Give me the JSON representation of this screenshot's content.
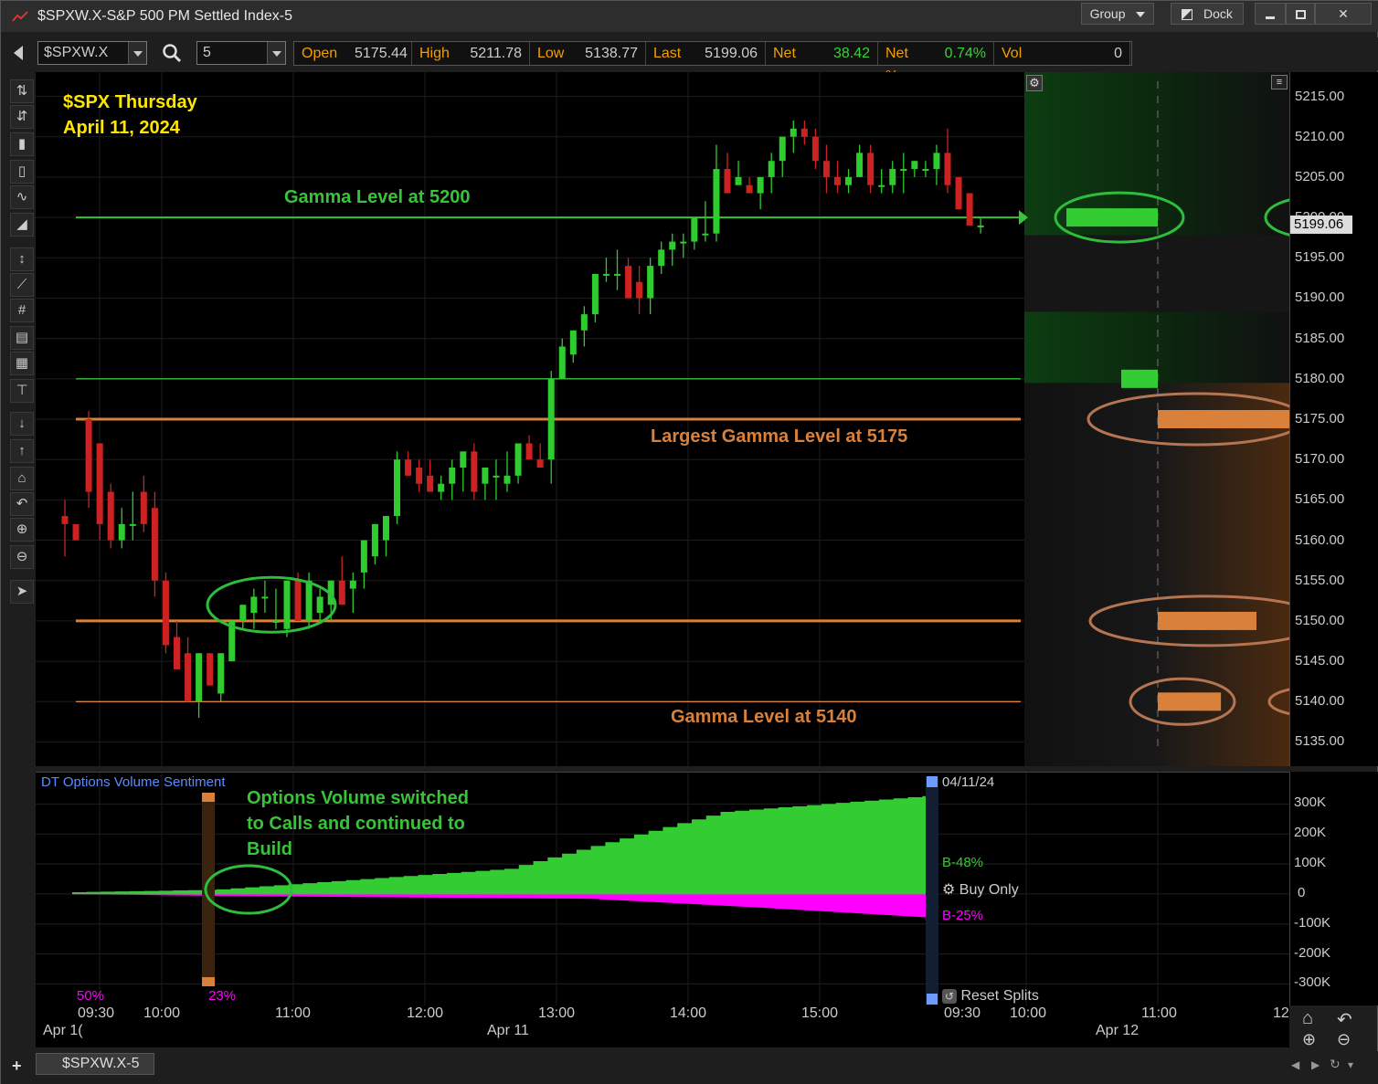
{
  "window": {
    "title": "$SPXW.X-S&P 500 PM Settled Index-5",
    "group_label": "Group",
    "dock_label": "Dock"
  },
  "toolbar": {
    "symbol": "$SPXW.X",
    "interval": "5",
    "quote": [
      {
        "label": "Open",
        "value": "5175.44",
        "color": "#cccccc"
      },
      {
        "label": "High",
        "value": "5211.78",
        "color": "#cccccc"
      },
      {
        "label": "Low",
        "value": "5138.77",
        "color": "#cccccc"
      },
      {
        "label": "Last",
        "value": "5199.06",
        "color": "#cccccc"
      },
      {
        "label": "Net",
        "value": "38.42",
        "color": "#3ccf3c"
      },
      {
        "label": "Net %",
        "value": "0.74%",
        "color": "#3ccf3c"
      },
      {
        "label": "Vol",
        "value": "0",
        "color": "#cccccc"
      }
    ]
  },
  "annotations": {
    "title_line1": "$SPX Thursday",
    "title_line2": "April 11, 2024",
    "gamma_5200": "Gamma Level at 5200",
    "largest_gamma": "Largest Gamma Level at 5175",
    "gamma_5140": "Gamma Level at 5140",
    "options_note_1": "Options Volume switched",
    "options_note_2": "to Calls and continued to",
    "options_note_3": "Build"
  },
  "price_axis": {
    "ticks": [
      "5215.00",
      "5210.00",
      "5205.00",
      "5200.00",
      "5195.00",
      "5190.00",
      "5185.00",
      "5180.00",
      "5175.00",
      "5170.00",
      "5165.00",
      "5160.00",
      "5155.00",
      "5150.00",
      "5145.00",
      "5140.00",
      "5135.00"
    ],
    "last_price": "5199.06"
  },
  "lower_panel": {
    "title": "DT Options Volume Sentiment",
    "date_label": "04/11/24",
    "calls_pct": "B-48%",
    "puts_pct": "B-25%",
    "buy_only": "Buy Only",
    "reset_splits": "Reset Splits",
    "left_pct": "50%",
    "split_pct": "23%",
    "axis_ticks": [
      "300K",
      "200K",
      "100K",
      "0",
      "-100K",
      "-200K",
      "-300K"
    ]
  },
  "time_axis": {
    "times": [
      "09:30",
      "10:00",
      "11:00",
      "12:00",
      "13:00",
      "14:00",
      "15:00",
      "09:30",
      "10:00",
      "11:00",
      "12"
    ],
    "dates": [
      "Apr 1(",
      "Apr 11",
      "Apr 12"
    ]
  },
  "status": {
    "tab_label": "$SPXW.X-5"
  },
  "chart_data": {
    "type": "candlestick",
    "title": "$SPX Thursday April 11, 2024",
    "ylim": [
      5132,
      5218
    ],
    "candles": [
      [
        5163,
        5165,
        5158,
        5162
      ],
      [
        5162,
        5162,
        5160,
        5160
      ],
      [
        5175,
        5176,
        5164,
        5166
      ],
      [
        5172,
        5172,
        5160,
        5162
      ],
      [
        5166,
        5167,
        5159,
        5160
      ],
      [
        5160,
        5164,
        5159,
        5162
      ],
      [
        5162,
        5166,
        5160,
        5162
      ],
      [
        5166,
        5168,
        5161,
        5162
      ],
      [
        5164,
        5166,
        5153,
        5155
      ],
      [
        5155,
        5156,
        5146,
        5147
      ],
      [
        5148,
        5150,
        5144,
        5144
      ],
      [
        5146,
        5148,
        5140,
        5140
      ],
      [
        5140,
        5146,
        5138,
        5146
      ],
      [
        5146,
        5146,
        5142,
        5142
      ],
      [
        5141,
        5146,
        5140,
        5146
      ],
      [
        5145,
        5150,
        5145,
        5150
      ],
      [
        5150,
        5152,
        5149,
        5152
      ],
      [
        5151,
        5154,
        5149,
        5153
      ],
      [
        5153,
        5155,
        5151,
        5153
      ],
      [
        5150,
        5154,
        5149,
        5150
      ],
      [
        5149,
        5155,
        5148,
        5155
      ],
      [
        5155,
        5156,
        5150,
        5150
      ],
      [
        5150,
        5156,
        5149,
        5155
      ],
      [
        5151,
        5154,
        5150,
        5153
      ],
      [
        5152,
        5155,
        5150,
        5155
      ],
      [
        5155,
        5158,
        5152,
        5152
      ],
      [
        5154,
        5156,
        5151,
        5155
      ],
      [
        5156,
        5160,
        5154,
        5160
      ],
      [
        5158,
        5162,
        5157,
        5162
      ],
      [
        5160,
        5163,
        5158,
        5163
      ],
      [
        5163,
        5171,
        5162,
        5170
      ],
      [
        5170,
        5171,
        5168,
        5168
      ],
      [
        5169,
        5170,
        5166,
        5167
      ],
      [
        5168,
        5170,
        5166,
        5166
      ],
      [
        5166,
        5168,
        5165,
        5167
      ],
      [
        5167,
        5170,
        5165,
        5169
      ],
      [
        5169,
        5171,
        5166,
        5171
      ],
      [
        5171,
        5172,
        5165,
        5166
      ],
      [
        5167,
        5169,
        5165,
        5169
      ],
      [
        5168,
        5170,
        5165,
        5168
      ],
      [
        5167,
        5171,
        5166,
        5168
      ],
      [
        5168,
        5172,
        5167,
        5172
      ],
      [
        5172,
        5173,
        5170,
        5170
      ],
      [
        5170,
        5172,
        5169,
        5169
      ],
      [
        5170,
        5181,
        5167,
        5180
      ],
      [
        5180,
        5185,
        5180,
        5184
      ],
      [
        5183,
        5186,
        5182,
        5186
      ],
      [
        5186,
        5189,
        5184,
        5188
      ],
      [
        5188,
        5193,
        5187,
        5193
      ],
      [
        5193,
        5195,
        5192,
        5193
      ],
      [
        5193,
        5196,
        5191,
        5193
      ],
      [
        5194,
        5195,
        5190,
        5190
      ],
      [
        5192,
        5194,
        5188,
        5190
      ],
      [
        5190,
        5195,
        5188,
        5194
      ],
      [
        5194,
        5197,
        5193,
        5196
      ],
      [
        5196,
        5198,
        5194,
        5197
      ],
      [
        5197,
        5198,
        5195,
        5197
      ],
      [
        5197,
        5200,
        5196,
        5200
      ],
      [
        5198,
        5202,
        5197,
        5198
      ],
      [
        5198,
        5209,
        5197,
        5206
      ],
      [
        5206,
        5208,
        5203,
        5203
      ],
      [
        5204,
        5207,
        5204,
        5205
      ],
      [
        5204,
        5205,
        5203,
        5203
      ],
      [
        5203,
        5205,
        5201,
        5205
      ],
      [
        5205,
        5208,
        5203,
        5207
      ],
      [
        5207,
        5210,
        5205,
        5210
      ],
      [
        5210,
        5212,
        5208,
        5211
      ],
      [
        5211,
        5212,
        5209,
        5210
      ],
      [
        5210,
        5211,
        5206,
        5207
      ],
      [
        5207,
        5209,
        5203,
        5205
      ],
      [
        5205,
        5207,
        5203,
        5204
      ],
      [
        5204,
        5206,
        5203,
        5205
      ],
      [
        5205,
        5209,
        5205,
        5208
      ],
      [
        5208,
        5209,
        5203,
        5204
      ],
      [
        5204,
        5206,
        5203,
        5204
      ],
      [
        5204,
        5207,
        5203,
        5206
      ],
      [
        5206,
        5208,
        5203,
        5206
      ],
      [
        5206,
        5207,
        5205,
        5207
      ],
      [
        5206,
        5207,
        5205,
        5206
      ],
      [
        5206,
        5209,
        5204,
        5208
      ],
      [
        5208,
        5211,
        5203,
        5204
      ],
      [
        5205,
        5205,
        5201,
        5201
      ],
      [
        5203,
        5203,
        5199,
        5199
      ],
      [
        5199,
        5200,
        5198,
        5199
      ]
    ],
    "gamma_levels": [
      {
        "price": 5200,
        "label": "Gamma Level at 5200",
        "color": "#39c339"
      },
      {
        "price": 5180,
        "label": "",
        "color": "#39c339"
      },
      {
        "price": 5175,
        "label": "Largest Gamma Level at 5175",
        "color": "#d9813a"
      },
      {
        "price": 5150,
        "label": "",
        "color": "#d9813a"
      },
      {
        "price": 5140,
        "label": "Gamma Level at 5140",
        "color": "#d9813a"
      }
    ],
    "gamma_profile": [
      {
        "price": 5200,
        "value": 0.55,
        "color": "#33cc33"
      },
      {
        "price": 5180,
        "value": 0.22,
        "color": "#33cc33"
      },
      {
        "price": 5175,
        "value": 1.0,
        "color": "#d9813a"
      },
      {
        "price": 5150,
        "value": 0.75,
        "color": "#d9813a"
      },
      {
        "price": 5140,
        "value": 0.48,
        "color": "#d9813a"
      }
    ],
    "sentiment": {
      "calls_max": 330000,
      "puts_min": -80000,
      "ylim": [
        -320000,
        350000
      ]
    },
    "colors": {
      "up": "#2ecc2e",
      "down": "#cc2222",
      "calls": "#33cc33",
      "puts": "#ff00ff"
    }
  }
}
